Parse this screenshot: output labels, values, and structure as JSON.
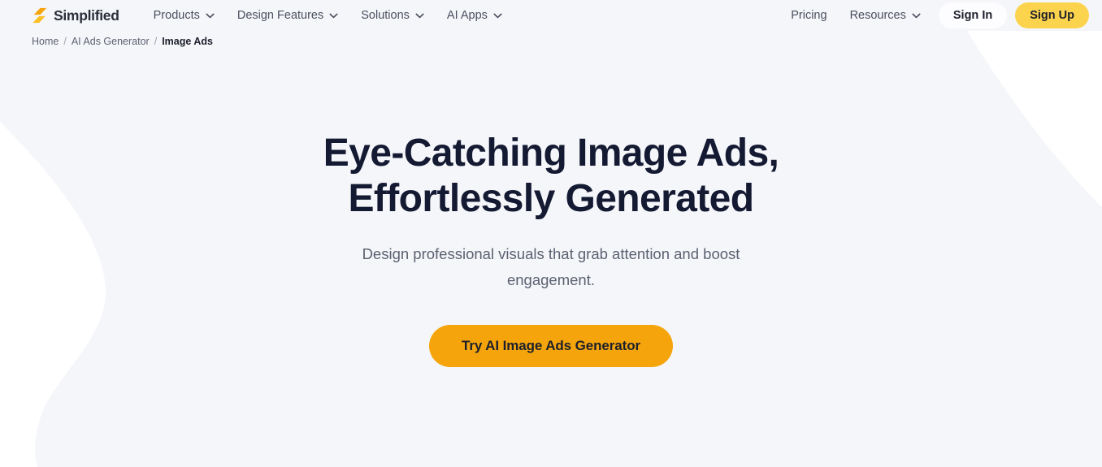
{
  "brand": {
    "name": "Simplified",
    "logo_icon": "simplified-bolt-logo",
    "logo_color": "#f5a50b"
  },
  "nav": {
    "left_items": [
      {
        "label": "Products",
        "icon": "chevron-down-icon",
        "has_dropdown": true
      },
      {
        "label": "Design Features",
        "icon": "chevron-down-icon",
        "has_dropdown": true
      },
      {
        "label": "Solutions",
        "icon": "chevron-down-icon",
        "has_dropdown": true
      },
      {
        "label": "AI Apps",
        "icon": "chevron-down-icon",
        "has_dropdown": true
      }
    ],
    "right_items": [
      {
        "label": "Pricing",
        "has_dropdown": false
      },
      {
        "label": "Resources",
        "icon": "chevron-down-icon",
        "has_dropdown": true
      }
    ],
    "sign_in_label": "Sign In",
    "sign_up_label": "Sign Up",
    "sign_up_color": "#fbd34d"
  },
  "breadcrumb": {
    "items": [
      {
        "label": "Home",
        "active": false
      },
      {
        "label": "AI Ads Generator",
        "active": false
      },
      {
        "label": "Image Ads",
        "active": true
      }
    ],
    "separator": "/"
  },
  "hero": {
    "title_line1": "Eye-Catching Image Ads,",
    "title_line2": "Effortlessly Generated",
    "subtitle": "Design professional visuals that grab attention and boost engagement.",
    "cta_label": "Try AI Image Ads Generator",
    "cta_color": "#f5a50b",
    "background_color": "#f5f6fa"
  }
}
